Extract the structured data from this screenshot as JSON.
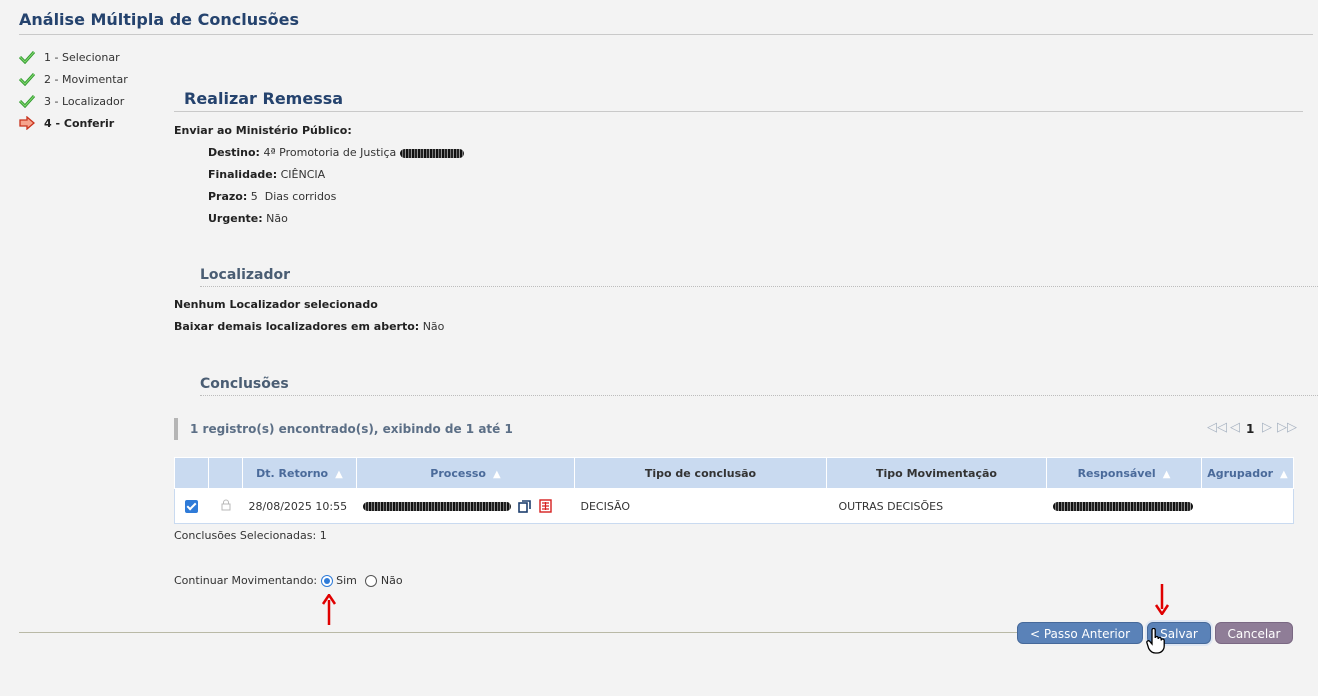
{
  "page_title": "Análise Múltipla de Conclusões",
  "steps": [
    {
      "label": "1 - Selecionar",
      "state": "done"
    },
    {
      "label": "2 - Movimentar",
      "state": "done"
    },
    {
      "label": "3 - Localizador",
      "state": "done"
    },
    {
      "label": "4 - Conferir",
      "state": "current"
    }
  ],
  "remessa": {
    "title": "Realizar Remessa",
    "heading": "Enviar ao Ministério Público:",
    "destino_label": "Destino:",
    "destino_value": "4ª Promotoria de Justiça",
    "finalidade_label": "Finalidade:",
    "finalidade_value": "CIÊNCIA",
    "prazo_label": "Prazo:",
    "prazo_value": "5  Dias corridos",
    "urgente_label": "Urgente:",
    "urgente_value": "Não"
  },
  "localizador": {
    "title": "Localizador",
    "none_text": "Nenhum Localizador selecionado",
    "baixar_label": "Baixar demais localizadores em aberto:",
    "baixar_value": "Não"
  },
  "conclusoes": {
    "title": "Conclusões",
    "records_text": "1 registro(s) encontrado(s), exibindo de 1 até 1",
    "current_page": "1",
    "columns": {
      "dt_retorno": "Dt. Retorno",
      "processo": "Processo",
      "tipo_conclusao": "Tipo de conclusão",
      "tipo_movimentacao": "Tipo Movimentação",
      "responsavel": "Responsável",
      "agrupador": "Agrupador"
    },
    "rows": [
      {
        "selected": true,
        "dt_retorno": "28/08/2025 10:55",
        "tipo_conclusao": "DECISÃO",
        "tipo_movimentacao": "OUTRAS DECISÕES",
        "agrupador": ""
      }
    ],
    "selected_text": "Conclusões Selecionadas: 1"
  },
  "continuar": {
    "label": "Continuar Movimentando:",
    "options": [
      "Sim",
      "Não"
    ],
    "selected": "Sim"
  },
  "buttons": {
    "prev": "< Passo Anterior",
    "save": "Salvar",
    "cancel": "Cancelar"
  },
  "colors": {
    "title": "#25436e",
    "header_bg": "#c9daf0",
    "button_blue": "#5a82b8",
    "button_mauve": "#8f7d97",
    "date_red": "#d62020",
    "annotation_arrow": "#e00000"
  }
}
